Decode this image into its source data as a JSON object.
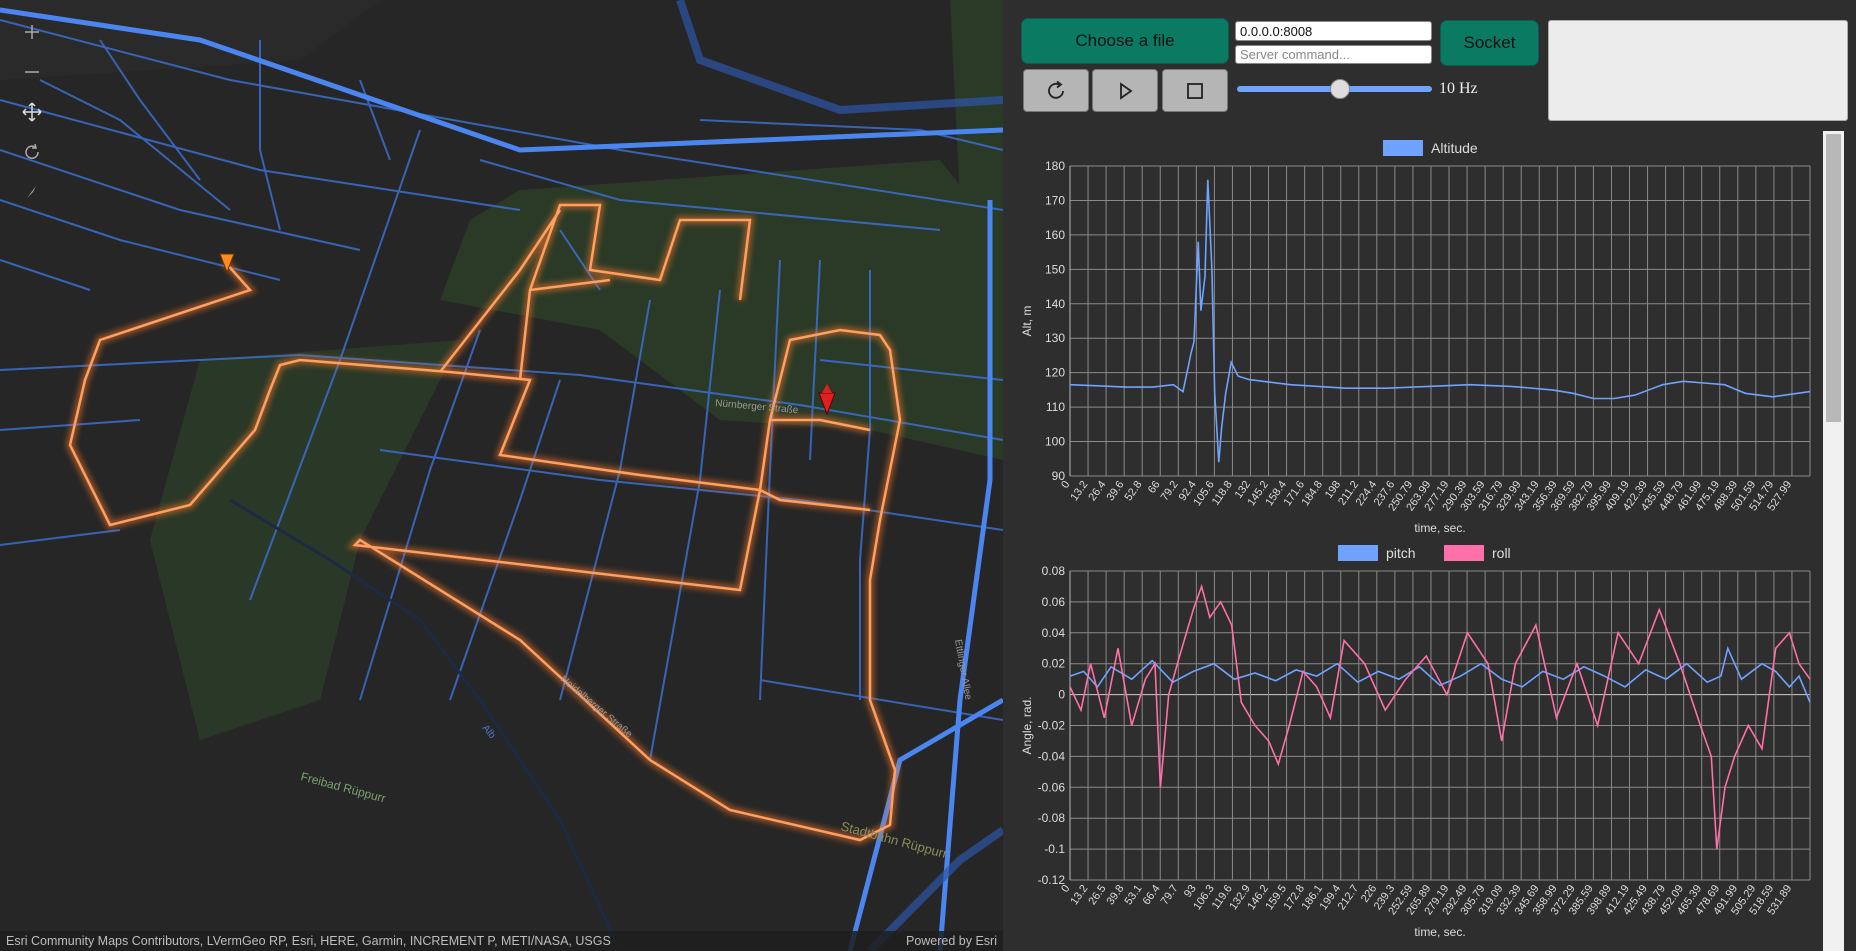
{
  "map": {
    "attribution": "Esri Community Maps Contributors, LVermGeo RP, Esri, HERE, Garmin, INCREMENT P, METI/NASA, USGS",
    "powered_by": "Powered by Esri",
    "street_labels": [
      "Nürnberger Straße",
      "Heidelberger Straße",
      "Ettlinger Allee",
      "Freibad Rüppurr",
      "Stadtbahn Rüppurr",
      "Alb"
    ]
  },
  "controls": {
    "choose_file_label": "Choose a file",
    "address_value": "0.0.0.0:8008",
    "command_placeholder": "Server command...",
    "socket_label": "Socket",
    "rate_label": "10 Hz",
    "rate_fraction": 0.53
  },
  "colors": {
    "accent": "#0b7a63",
    "altitude": "#6fa3ff",
    "pitch": "#6fa3ff",
    "roll": "#ff6fa8",
    "track": "#ff8a3d"
  },
  "chart_data": [
    {
      "type": "line",
      "xlabel": "time, sec.",
      "ylabel": "Alt, m",
      "ylim": [
        90,
        180
      ],
      "yticks": [
        180,
        170,
        160,
        150,
        140,
        130,
        120,
        110,
        100,
        90
      ],
      "xticks": [
        "0",
        "13.2",
        "26.4",
        "39.6",
        "52.8",
        "66",
        "79.2",
        "92.4",
        "105.6",
        "118.8",
        "132",
        "145.2",
        "158.4",
        "171.6",
        "184.8",
        "198",
        "211.2",
        "224.4",
        "237.6",
        "250.79",
        "263.99",
        "277.19",
        "290.39",
        "303.59",
        "316.79",
        "329.99",
        "343.19",
        "356.39",
        "369.59",
        "382.79",
        "395.99",
        "409.19",
        "422.39",
        "435.59",
        "448.79",
        "461.99",
        "475.19",
        "488.39",
        "501.59",
        "514.79",
        "527.99"
      ],
      "xlim": [
        0,
        537
      ],
      "grid": true,
      "legend": "top-center",
      "series": [
        {
          "name": "Altitude",
          "x": [
            0,
            20,
            40,
            60,
            75,
            82,
            88,
            90,
            93,
            95,
            98,
            100,
            103,
            105,
            108,
            110,
            113,
            117,
            122,
            130,
            140,
            160,
            180,
            200,
            230,
            260,
            290,
            320,
            350,
            365,
            380,
            395,
            410,
            430,
            445,
            460,
            475,
            490,
            510,
            537
          ],
          "y": [
            116.5,
            116.2,
            115.8,
            115.8,
            116.5,
            114.5,
            126,
            129,
            158,
            138,
            148,
            176,
            150,
            114,
            94,
            104,
            114,
            123,
            119,
            118,
            117.5,
            116.5,
            116,
            115.5,
            115.5,
            116,
            116.5,
            116,
            115,
            114,
            112.5,
            112.5,
            113.5,
            116.5,
            117.5,
            117,
            116.5,
            114,
            113,
            114.5
          ]
        }
      ]
    },
    {
      "type": "line",
      "xlabel": "time, sec.",
      "ylabel": "Angle, rad.",
      "ylim": [
        -0.12,
        0.08
      ],
      "yticks": [
        0.08,
        0.06,
        0.04,
        0.02,
        0,
        -0.02,
        -0.04,
        -0.06,
        -0.08,
        -0.1,
        -0.12
      ],
      "xticks": [
        "0",
        "13.2",
        "26.5",
        "39.8",
        "53.1",
        "66.4",
        "79.7",
        "93",
        "106.3",
        "119.6",
        "132.9",
        "146.2",
        "159.5",
        "172.8",
        "186.1",
        "199.4",
        "212.7",
        "226",
        "239.3",
        "252.59",
        "265.89",
        "279.19",
        "292.49",
        "305.79",
        "319.09",
        "332.39",
        "345.69",
        "358.99",
        "372.29",
        "385.59",
        "398.89",
        "412.19",
        "425.49",
        "438.79",
        "452.09",
        "465.39",
        "478.69",
        "491.99",
        "505.29",
        "518.59",
        "531.89"
      ],
      "xlim": [
        0,
        540
      ],
      "grid": true,
      "legend": "top-center",
      "series": [
        {
          "name": "pitch",
          "x": [
            0,
            10,
            20,
            30,
            45,
            60,
            75,
            90,
            105,
            120,
            135,
            150,
            165,
            180,
            195,
            210,
            225,
            240,
            255,
            270,
            285,
            300,
            315,
            330,
            345,
            360,
            375,
            390,
            405,
            420,
            435,
            450,
            465,
            475,
            480,
            490,
            505,
            515,
            525,
            532,
            540
          ],
          "y": [
            0.012,
            0.015,
            0.005,
            0.018,
            0.01,
            0.022,
            0.008,
            0.015,
            0.02,
            0.01,
            0.014,
            0.009,
            0.016,
            0.012,
            0.02,
            0.008,
            0.015,
            0.01,
            0.018,
            0.006,
            0.012,
            0.02,
            0.01,
            0.005,
            0.015,
            0.01,
            0.018,
            0.012,
            0.005,
            0.016,
            0.01,
            0.02,
            0.008,
            0.012,
            0.03,
            0.01,
            0.02,
            0.015,
            0.005,
            0.012,
            -0.005
          ]
        },
        {
          "name": "roll",
          "x": [
            0,
            8,
            15,
            25,
            35,
            45,
            55,
            62,
            66,
            72,
            80,
            90,
            96,
            102,
            110,
            118,
            125,
            135,
            145,
            152,
            160,
            170,
            180,
            190,
            200,
            215,
            230,
            245,
            260,
            275,
            290,
            305,
            315,
            325,
            340,
            355,
            370,
            385,
            400,
            415,
            430,
            445,
            460,
            468,
            472,
            478,
            485,
            495,
            505,
            515,
            525,
            532,
            540
          ],
          "y": [
            0.005,
            -0.01,
            0.02,
            -0.015,
            0.03,
            -0.02,
            0.01,
            0.02,
            -0.06,
            0.0,
            0.025,
            0.055,
            0.07,
            0.05,
            0.06,
            0.045,
            -0.005,
            -0.02,
            -0.03,
            -0.045,
            -0.02,
            0.015,
            0.005,
            -0.015,
            0.035,
            0.02,
            -0.01,
            0.01,
            0.025,
            0.0,
            0.04,
            0.02,
            -0.03,
            0.02,
            0.045,
            -0.015,
            0.02,
            -0.02,
            0.04,
            0.02,
            0.055,
            0.02,
            -0.02,
            -0.04,
            -0.1,
            -0.06,
            -0.04,
            -0.02,
            -0.035,
            0.03,
            0.04,
            0.02,
            0.01
          ]
        }
      ]
    }
  ]
}
